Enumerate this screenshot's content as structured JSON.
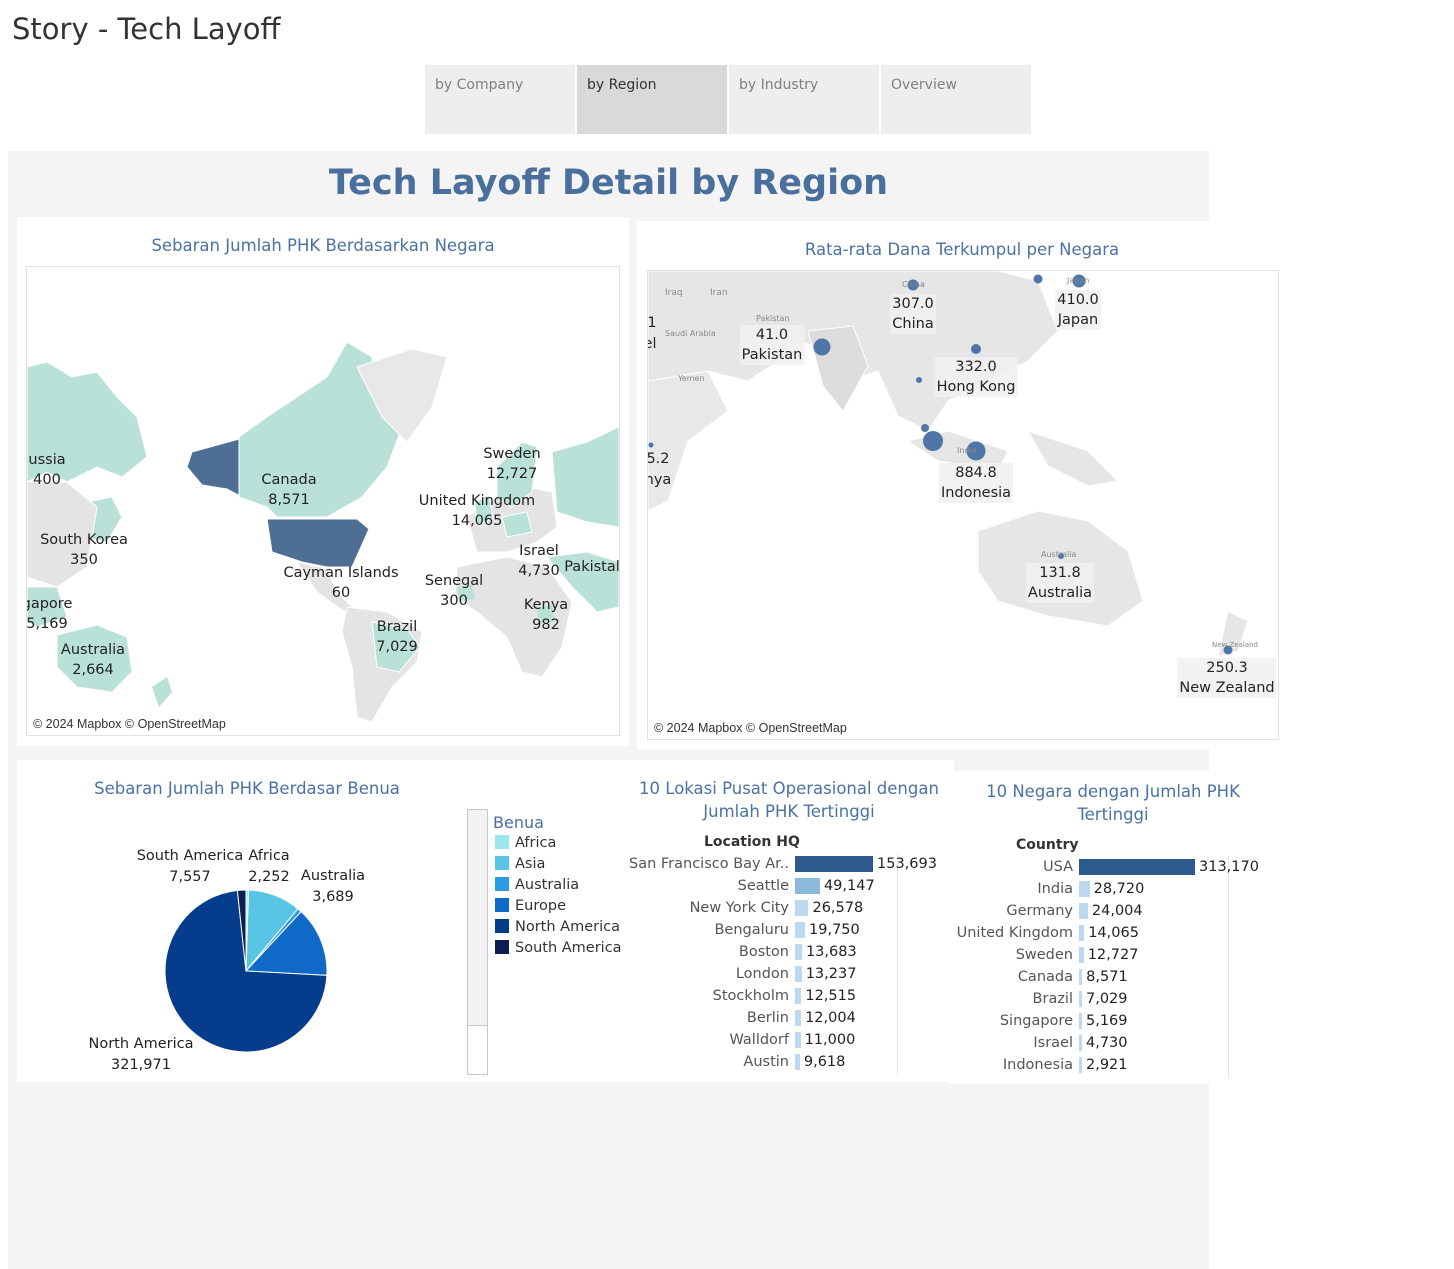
{
  "story": {
    "title": "Story - Tech Layoff",
    "tabs": [
      {
        "label": "by Company"
      },
      {
        "label": "by Region"
      },
      {
        "label": "by Industry"
      },
      {
        "label": "Overview"
      }
    ]
  },
  "dashboard": {
    "title": "Tech Layoff Detail by Region"
  },
  "map_layoffs": {
    "title": "Sebaran Jumlah PHK Berdasarkan Negara",
    "credit": "© 2024 Mapbox © OpenStreetMap",
    "labels": [
      {
        "name": "ussia",
        "value": "400"
      },
      {
        "name": "Canada",
        "value": "8,571"
      },
      {
        "name": "Sweden",
        "value": "12,727"
      },
      {
        "name": "United Kingdom",
        "value": "14,065"
      },
      {
        "name": "South Korea",
        "value": "350"
      },
      {
        "name": "Cayman Islands",
        "value": "60"
      },
      {
        "name": "Israel",
        "value": "4,730"
      },
      {
        "name": "Pakistal",
        "value": ""
      },
      {
        "name": "Senegal",
        "value": "300"
      },
      {
        "name": "gapore",
        "value": "5,169"
      },
      {
        "name": "Kenya",
        "value": "982"
      },
      {
        "name": "Brazil",
        "value": "7,029"
      },
      {
        "name": "Australia",
        "value": "2,664"
      }
    ]
  },
  "map_funds": {
    "title": "Rata-rata Dana Terkumpul per Negara",
    "credit": "© 2024 Mapbox © OpenStreetMap",
    "places": [
      "Iraq",
      "Iran",
      "Saudi Arabia",
      "Yemen",
      "Pakistan",
      "China",
      "Japan",
      "India",
      "Australia",
      "New Zealand"
    ],
    "labels": [
      {
        "value": "307.0",
        "name": "China"
      },
      {
        "value": "410.0",
        "name": "Japan"
      },
      {
        "value": "41.0",
        "name": "Pakistan"
      },
      {
        "value": "332.0",
        "name": "Hong Kong"
      },
      {
        "value": "884.8",
        "name": "Indonesia"
      },
      {
        "value": "131.8",
        "name": "Australia"
      },
      {
        "value": "250.3",
        "name": "New Zealand"
      },
      {
        "value": "5.2",
        "name": "nya"
      }
    ],
    "edge_text": [
      "1",
      "el"
    ]
  },
  "continent_pie": {
    "title": "Sebaran Jumlah PHK Berdasar Benua",
    "legend_title": "Benua",
    "colors": {
      "Africa": "#9be8ec",
      "Asia": "#59c5e4",
      "Australia": "#2b9ce3",
      "Europe": "#0f6ac7",
      "North America": "#063c8c",
      "South America": "#0b1f52"
    },
    "chart_data": {
      "type": "pie",
      "categories": [
        "Africa",
        "Asia",
        "Australia",
        "Europe",
        "North America",
        "South America"
      ],
      "values": [
        2252,
        47000,
        3689,
        62000,
        321971,
        7557
      ],
      "labels": [
        {
          "name": "South America",
          "value": "7,557"
        },
        {
          "name": "Africa",
          "value": "2,252"
        },
        {
          "name": "Australia",
          "value": "3,689"
        },
        {
          "name": "North America",
          "value": "321,971"
        }
      ]
    }
  },
  "hq_bars": {
    "title_line1": "10 Lokasi Pusat Operasional dengan",
    "title_line2": "Jumlah PHK Tertinggi",
    "column_header": "Location HQ",
    "colors": {
      "top": "#2c5a8c",
      "mid": "#8db9dd",
      "low": "#bcd9ef"
    },
    "chart_data": {
      "type": "bar",
      "orientation": "horizontal",
      "categories": [
        "San Francisco Bay Ar..",
        "Seattle",
        "New York City",
        "Bengaluru",
        "Boston",
        "London",
        "Stockholm",
        "Berlin",
        "Walldorf",
        "Austin"
      ],
      "values": [
        153693,
        49147,
        26578,
        19750,
        13683,
        13237,
        12515,
        12004,
        11000,
        9618
      ],
      "value_labels": [
        "153,693",
        "49,147",
        "26,578",
        "19,750",
        "13,683",
        "13,237",
        "12,515",
        "12,004",
        "11,000",
        "9,618"
      ]
    }
  },
  "country_bars": {
    "title_line1": "10 Negara dengan Jumlah PHK",
    "title_line2": "Tertinggi",
    "column_header": "Country",
    "colors": {
      "top": "#2c5a8c",
      "low": "#bcd9ef"
    },
    "chart_data": {
      "type": "bar",
      "orientation": "horizontal",
      "categories": [
        "USA",
        "India",
        "Germany",
        "United Kingdom",
        "Sweden",
        "Canada",
        "Brazil",
        "Singapore",
        "Israel",
        "Indonesia"
      ],
      "values": [
        313170,
        28720,
        24004,
        14065,
        12727,
        8571,
        7029,
        5169,
        4730,
        2921
      ],
      "value_labels": [
        "313,170",
        "28,720",
        "24,004",
        "14,065",
        "12,727",
        "8,571",
        "7,029",
        "5,169",
        "4,730",
        "2,921"
      ]
    }
  }
}
